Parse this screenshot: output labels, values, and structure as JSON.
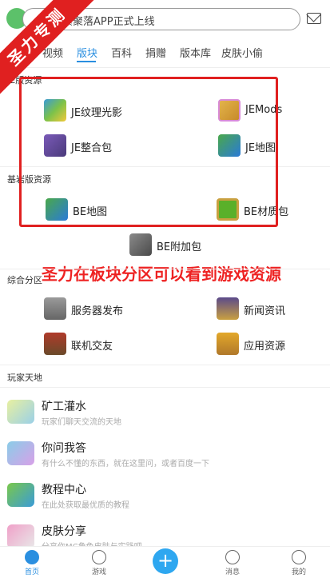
{
  "search": {
    "placeholder": "像素聚落APP正式上线"
  },
  "tabs": [
    {
      "label": "视频"
    },
    {
      "label": "版块",
      "active": true
    },
    {
      "label": "百科"
    },
    {
      "label": "捐赠"
    },
    {
      "label": "版本库"
    },
    {
      "label": "皮肤小偷"
    }
  ],
  "sections": {
    "je": "JE版资源",
    "be": "基岩版资源",
    "general": "综合分区",
    "players": "玩家天地"
  },
  "je_items": [
    {
      "label": "JE纹理光影",
      "icon": "texture-icon"
    },
    {
      "label": "JEMods",
      "icon": "mods-icon"
    },
    {
      "label": "JE整合包",
      "icon": "modpack-icon"
    },
    {
      "label": "JE地图",
      "icon": "map-icon"
    }
  ],
  "be_items": [
    {
      "label": "BE地图",
      "icon": "map-icon"
    },
    {
      "label": "BE材质包",
      "icon": "creeper-icon"
    },
    {
      "label": "BE附加包",
      "icon": "addon-icon"
    }
  ],
  "general_items": [
    {
      "label": "服务器发布",
      "icon": "server-icon"
    },
    {
      "label": "新闻资讯",
      "icon": "news-icon"
    },
    {
      "label": "联机交友",
      "icon": "multiplayer-icon"
    },
    {
      "label": "应用资源",
      "icon": "apps-icon"
    }
  ],
  "player_items": [
    {
      "title": "矿工灌水",
      "subtitle": "玩家们聊天交流的天地"
    },
    {
      "title": "你问我答",
      "subtitle": "有什么不懂的东西，就在这里问，或者百度一下"
    },
    {
      "title": "教程中心",
      "subtitle": "在此处获取最优质的教程"
    },
    {
      "title": "皮肤分享",
      "subtitle": "分享你MC角色皮肤与实践吧"
    }
  ],
  "watermark": {
    "ribbon": "圣力专测",
    "banner": "圣力在板块分区可以看到游戏资源"
  },
  "bottom_nav": [
    {
      "label": "首页",
      "active": true
    },
    {
      "label": "游戏"
    },
    {
      "label": "+"
    },
    {
      "label": "消息"
    },
    {
      "label": "我的"
    }
  ],
  "colors": {
    "accent": "#2a8fe0",
    "highlight": "#e02020"
  }
}
